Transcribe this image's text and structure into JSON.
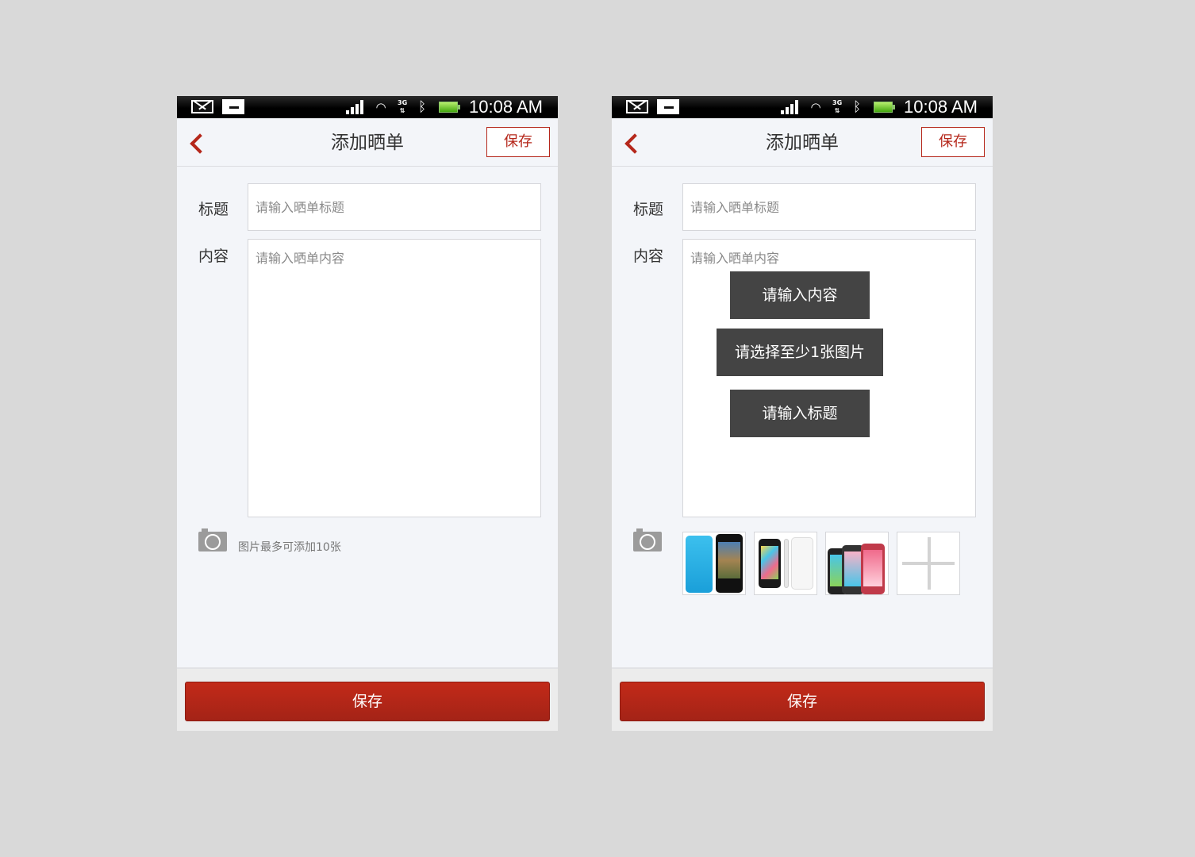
{
  "status_bar": {
    "time": "10:08 AM",
    "network": "3G"
  },
  "header": {
    "title": "添加晒单",
    "save_label": "保存"
  },
  "form": {
    "title_label": "标题",
    "title_placeholder": "请输入晒单标题",
    "content_label": "内容",
    "content_placeholder": "请输入晒单内容",
    "photo_hint": "图片最多可添加10张"
  },
  "toasts": [
    "请输入内容",
    "请选择至少1张图片",
    "请输入标题"
  ],
  "photos": [
    {
      "icon": "iphone-5c-blue-photo"
    },
    {
      "icon": "iphone-5c-white-photo"
    },
    {
      "icon": "iphone-5c-colors-photo"
    }
  ],
  "footer": {
    "save_label": "保存"
  },
  "colors": {
    "accent": "#b5271b",
    "toast_bg": "#444444",
    "page_bg": "#f3f5f9"
  }
}
